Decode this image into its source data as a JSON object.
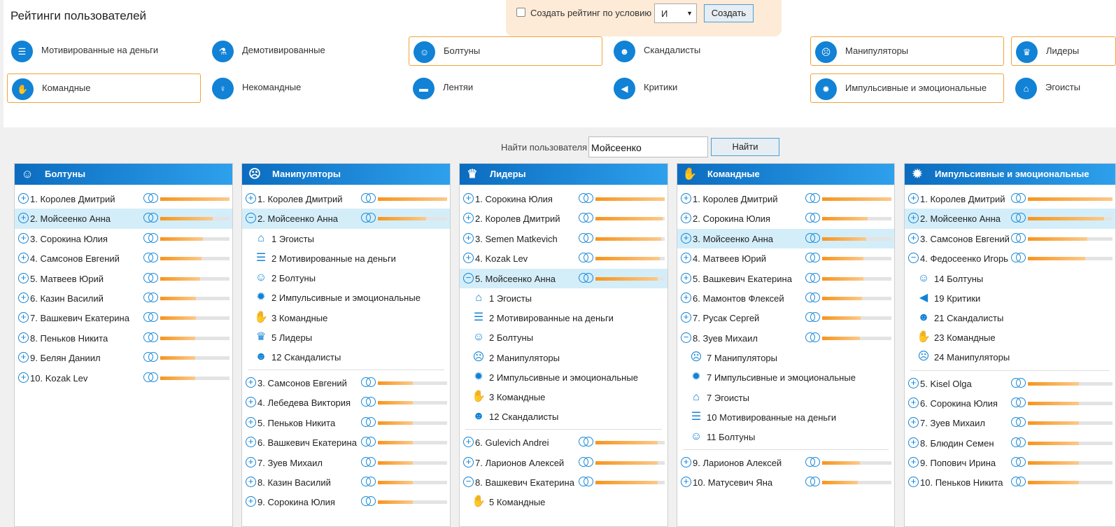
{
  "page": {
    "title": "Рейтинги пользователей"
  },
  "condition": {
    "checkbox_label": "Создать рейтинг по условию",
    "operator": "И",
    "create_label": "Создать"
  },
  "categories": [
    {
      "label": "Мотивированные на деньги",
      "icon": "coins-icon",
      "glyph": "☰",
      "highlighted": false
    },
    {
      "label": "Демотивированные",
      "icon": "broom-icon",
      "glyph": "⚗",
      "highlighted": false
    },
    {
      "label": "Болтуны",
      "icon": "talker-icon",
      "glyph": "☺",
      "highlighted": true
    },
    {
      "label": "Скандалисты",
      "icon": "shouter-icon",
      "glyph": "☻",
      "highlighted": false
    },
    {
      "label": "Манипуляторы",
      "icon": "mask-icon",
      "glyph": "☹",
      "highlighted": true
    },
    {
      "label": "Лидеры",
      "icon": "trophy-icon",
      "glyph": "♛",
      "highlighted": true
    },
    {
      "label": "Командные",
      "icon": "handshake-icon",
      "glyph": "✋",
      "highlighted": true
    },
    {
      "label": "Некомандные",
      "icon": "person-icon",
      "glyph": "♀",
      "highlighted": false
    },
    {
      "label": "Лентяи",
      "icon": "bed-icon",
      "glyph": "▬",
      "highlighted": false
    },
    {
      "label": "Критики",
      "icon": "megaphone-icon",
      "glyph": "◀",
      "highlighted": false
    },
    {
      "label": "Импульсивные и эмоциональные",
      "icon": "grenade-icon",
      "glyph": "✹",
      "highlighted": true
    },
    {
      "label": "Эгоисты",
      "icon": "house-icon",
      "glyph": "⌂",
      "highlighted": false
    }
  ],
  "search": {
    "label": "Найти пользователя",
    "value": "Мойсеенко",
    "button": "Найти"
  },
  "panels": [
    {
      "title": "Болтуны",
      "icon": "talker-icon",
      "glyph": "☺",
      "rows": [
        {
          "t": "r",
          "num": "1.",
          "name": "Королев Дмитрий",
          "fill": 1.0,
          "exp": false,
          "sel": false
        },
        {
          "t": "r",
          "num": "2.",
          "name": "Мойсеенко Анна",
          "fill": 0.76,
          "exp": false,
          "sel": true
        },
        {
          "t": "r",
          "num": "3.",
          "name": "Сорокина Юлия",
          "fill": 0.62,
          "exp": false,
          "sel": false
        },
        {
          "t": "r",
          "num": "4.",
          "name": "Самсонов Евгений",
          "fill": 0.6,
          "exp": false,
          "sel": false
        },
        {
          "t": "r",
          "num": "5.",
          "name": "Матвеев Юрий",
          "fill": 0.58,
          "exp": false,
          "sel": false
        },
        {
          "t": "r",
          "num": "6.",
          "name": "Казин Василий",
          "fill": 0.52,
          "exp": false,
          "sel": false
        },
        {
          "t": "r",
          "num": "7.",
          "name": "Вашкевич Екатерина",
          "fill": 0.52,
          "exp": false,
          "sel": false
        },
        {
          "t": "r",
          "num": "8.",
          "name": "Пеньков Никита",
          "fill": 0.5,
          "exp": false,
          "sel": false
        },
        {
          "t": "r",
          "num": "9.",
          "name": "Белян Даниил",
          "fill": 0.5,
          "exp": false,
          "sel": false
        },
        {
          "t": "r",
          "num": "10.",
          "name": "Kozak Lev",
          "fill": 0.5,
          "exp": false,
          "sel": false
        }
      ]
    },
    {
      "title": "Манипуляторы",
      "icon": "mask-icon",
      "glyph": "☹",
      "rows": [
        {
          "t": "r",
          "num": "1.",
          "name": "Королев Дмитрий",
          "fill": 1.0,
          "exp": false,
          "sel": false
        },
        {
          "t": "r",
          "num": "2.",
          "name": "Мойсеенко Анна",
          "fill": 0.7,
          "exp": true,
          "sel": true
        },
        {
          "t": "s",
          "n": "1",
          "label": "Эгоисты",
          "icon": "house-icon",
          "glyph": "⌂"
        },
        {
          "t": "s",
          "n": "2",
          "label": "Мотивированные на деньги",
          "icon": "coins-icon",
          "glyph": "☰"
        },
        {
          "t": "s",
          "n": "2",
          "label": "Болтуны",
          "icon": "talker-icon",
          "glyph": "☺"
        },
        {
          "t": "s",
          "n": "2",
          "label": "Импульсивные и эмоциональные",
          "icon": "grenade-icon",
          "glyph": "✹"
        },
        {
          "t": "s",
          "n": "3",
          "label": "Командные",
          "icon": "handshake-icon",
          "glyph": "✋"
        },
        {
          "t": "s",
          "n": "5",
          "label": "Лидеры",
          "icon": "trophy-icon",
          "glyph": "♛"
        },
        {
          "t": "s",
          "n": "12",
          "label": "Скандалисты",
          "icon": "shouter-icon",
          "glyph": "☻"
        },
        {
          "t": "sep"
        },
        {
          "t": "r",
          "num": "3.",
          "name": "Самсонов Евгений",
          "fill": 0.5,
          "exp": false,
          "sel": false
        },
        {
          "t": "r",
          "num": "4.",
          "name": "Лебедева Виктория",
          "fill": 0.5,
          "exp": false,
          "sel": false
        },
        {
          "t": "r",
          "num": "5.",
          "name": "Пеньков Никита",
          "fill": 0.5,
          "exp": false,
          "sel": false
        },
        {
          "t": "r",
          "num": "6.",
          "name": "Вашкевич Екатерина",
          "fill": 0.5,
          "exp": false,
          "sel": false
        },
        {
          "t": "r",
          "num": "7.",
          "name": "Зуев Михаил",
          "fill": 0.5,
          "exp": false,
          "sel": false
        },
        {
          "t": "r",
          "num": "8.",
          "name": "Казин Василий",
          "fill": 0.5,
          "exp": false,
          "sel": false
        },
        {
          "t": "r",
          "num": "9.",
          "name": "Сорокина Юлия",
          "fill": 0.5,
          "exp": false,
          "sel": false
        }
      ]
    },
    {
      "title": "Лидеры",
      "icon": "trophy-icon",
      "glyph": "♛",
      "rows": [
        {
          "t": "r",
          "num": "1.",
          "name": "Сорокина Юлия",
          "fill": 1.0,
          "exp": false,
          "sel": false
        },
        {
          "t": "r",
          "num": "2.",
          "name": "Королев Дмитрий",
          "fill": 0.97,
          "exp": false,
          "sel": false
        },
        {
          "t": "r",
          "num": "3.",
          "name": "Semen Matkevich",
          "fill": 0.95,
          "exp": false,
          "sel": false
        },
        {
          "t": "r",
          "num": "4.",
          "name": "Kozak Lev",
          "fill": 0.93,
          "exp": false,
          "sel": false
        },
        {
          "t": "r",
          "num": "5.",
          "name": "Мойсеенко Анна",
          "fill": 0.9,
          "exp": true,
          "sel": true
        },
        {
          "t": "s",
          "n": "1",
          "label": "Эгоисты",
          "icon": "house-icon",
          "glyph": "⌂"
        },
        {
          "t": "s",
          "n": "2",
          "label": "Мотивированные на деньги",
          "icon": "coins-icon",
          "glyph": "☰"
        },
        {
          "t": "s",
          "n": "2",
          "label": "Болтуны",
          "icon": "talker-icon",
          "glyph": "☺"
        },
        {
          "t": "s",
          "n": "2",
          "label": "Манипуляторы",
          "icon": "mask-icon",
          "glyph": "☹"
        },
        {
          "t": "s",
          "n": "2",
          "label": "Импульсивные и эмоциональные",
          "icon": "grenade-icon",
          "glyph": "✹"
        },
        {
          "t": "s",
          "n": "3",
          "label": "Командные",
          "icon": "handshake-icon",
          "glyph": "✋"
        },
        {
          "t": "s",
          "n": "12",
          "label": "Скандалисты",
          "icon": "shouter-icon",
          "glyph": "☻"
        },
        {
          "t": "sep"
        },
        {
          "t": "r",
          "num": "6.",
          "name": "Gulevich Andrei",
          "fill": 0.9,
          "exp": false,
          "sel": false
        },
        {
          "t": "r",
          "num": "7.",
          "name": "Ларионов Алексей",
          "fill": 0.9,
          "exp": false,
          "sel": false
        },
        {
          "t": "r",
          "num": "8.",
          "name": "Вашкевич Екатерина",
          "fill": 0.9,
          "exp": true,
          "sel": false
        },
        {
          "t": "s",
          "n": "5",
          "label": "Командные",
          "icon": "handshake-icon",
          "glyph": "✋"
        }
      ]
    },
    {
      "title": "Командные",
      "icon": "handshake-icon",
      "glyph": "✋",
      "rows": [
        {
          "t": "r",
          "num": "1.",
          "name": "Королев Дмитрий",
          "fill": 1.0,
          "exp": false,
          "sel": false
        },
        {
          "t": "r",
          "num": "2.",
          "name": "Сорокина Юлия",
          "fill": 0.66,
          "exp": false,
          "sel": false
        },
        {
          "t": "r",
          "num": "3.",
          "name": "Мойсеенко Анна",
          "fill": 0.64,
          "exp": false,
          "sel": true
        },
        {
          "t": "r",
          "num": "4.",
          "name": "Матвеев Юрий",
          "fill": 0.6,
          "exp": false,
          "sel": false
        },
        {
          "t": "r",
          "num": "5.",
          "name": "Вашкевич Екатерина",
          "fill": 0.6,
          "exp": false,
          "sel": false
        },
        {
          "t": "r",
          "num": "6.",
          "name": "Мамонтов Флексей",
          "fill": 0.58,
          "exp": false,
          "sel": false
        },
        {
          "t": "r",
          "num": "7.",
          "name": "Русак Сергей",
          "fill": 0.56,
          "exp": false,
          "sel": false
        },
        {
          "t": "r",
          "num": "8.",
          "name": "Зуев Михаил",
          "fill": 0.55,
          "exp": true,
          "sel": false
        },
        {
          "t": "s",
          "n": "7",
          "label": "Манипуляторы",
          "icon": "mask-icon",
          "glyph": "☹"
        },
        {
          "t": "s",
          "n": "7",
          "label": "Импульсивные и эмоциональные",
          "icon": "grenade-icon",
          "glyph": "✹"
        },
        {
          "t": "s",
          "n": "7",
          "label": "Эгоисты",
          "icon": "house-icon",
          "glyph": "⌂"
        },
        {
          "t": "s",
          "n": "10",
          "label": "Мотивированные на деньги",
          "icon": "coins-icon",
          "glyph": "☰"
        },
        {
          "t": "s",
          "n": "11",
          "label": "Болтуны",
          "icon": "talker-icon",
          "glyph": "☺"
        },
        {
          "t": "sep"
        },
        {
          "t": "r",
          "num": "9.",
          "name": "Ларионов Алексей",
          "fill": 0.55,
          "exp": false,
          "sel": false
        },
        {
          "t": "r",
          "num": "10.",
          "name": "Матусевич Яна",
          "fill": 0.52,
          "exp": false,
          "sel": false
        }
      ]
    },
    {
      "title": "Импульсивные и эмоциональные",
      "icon": "grenade-icon",
      "glyph": "✹",
      "rows": [
        {
          "t": "r",
          "num": "1.",
          "name": "Королев Дмитрий",
          "fill": 1.0,
          "exp": false,
          "sel": false
        },
        {
          "t": "r",
          "num": "2.",
          "name": "Мойсеенко Анна",
          "fill": 0.9,
          "exp": false,
          "sel": true
        },
        {
          "t": "r",
          "num": "3.",
          "name": "Самсонов Евгений",
          "fill": 0.7,
          "exp": false,
          "sel": false
        },
        {
          "t": "r",
          "num": "4.",
          "name": "Федосеенко Игорь",
          "fill": 0.68,
          "exp": true,
          "sel": false
        },
        {
          "t": "s",
          "n": "14",
          "label": "Болтуны",
          "icon": "talker-icon",
          "glyph": "☺"
        },
        {
          "t": "s",
          "n": "19",
          "label": "Критики",
          "icon": "megaphone-icon",
          "glyph": "◀"
        },
        {
          "t": "s",
          "n": "21",
          "label": "Скандалисты",
          "icon": "shouter-icon",
          "glyph": "☻"
        },
        {
          "t": "s",
          "n": "23",
          "label": "Командные",
          "icon": "handshake-icon",
          "glyph": "✋"
        },
        {
          "t": "s",
          "n": "24",
          "label": "Манипуляторы",
          "icon": "mask-icon",
          "glyph": "☹"
        },
        {
          "t": "sep"
        },
        {
          "t": "r",
          "num": "5.",
          "name": "Kisel Olga",
          "fill": 0.6,
          "exp": false,
          "sel": false
        },
        {
          "t": "r",
          "num": "6.",
          "name": "Сорокина Юлия",
          "fill": 0.6,
          "exp": false,
          "sel": false
        },
        {
          "t": "r",
          "num": "7.",
          "name": "Зуев Михаил",
          "fill": 0.6,
          "exp": false,
          "sel": false
        },
        {
          "t": "r",
          "num": "8.",
          "name": "Блюдин Семен",
          "fill": 0.6,
          "exp": false,
          "sel": false
        },
        {
          "t": "r",
          "num": "9.",
          "name": "Попович Ирина",
          "fill": 0.6,
          "exp": false,
          "sel": false
        },
        {
          "t": "r",
          "num": "10.",
          "name": "Пеньков Никита",
          "fill": 0.6,
          "exp": false,
          "sel": false
        }
      ]
    }
  ]
}
